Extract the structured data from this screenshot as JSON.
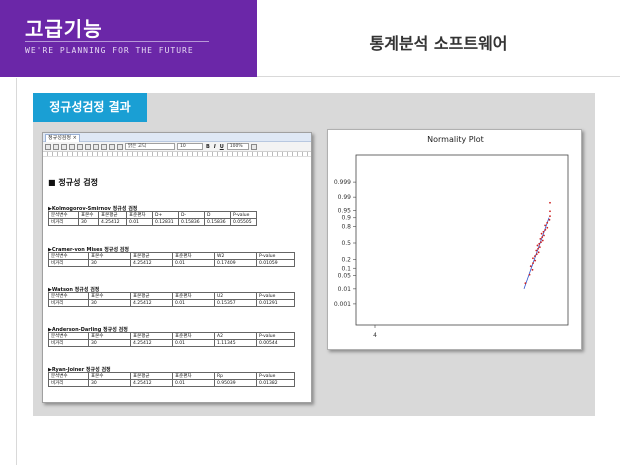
{
  "brand": {
    "title": "고급기능",
    "subtitle": "WE'RE PLANNING FOR THE FUTURE"
  },
  "header": {
    "title": "통계분석 소프트웨어"
  },
  "section": {
    "title": "정규성검정 결과"
  },
  "document": {
    "tab_label": "정규성검정",
    "tab_close": "×",
    "toolbar": {
      "font": "맑은 고딕",
      "size": "10",
      "bold": "B",
      "italic": "I",
      "underline": "U",
      "zoom": "100%"
    },
    "heading": "■ 정규성 검정",
    "tests": [
      {
        "title": "▶Kolmogorov-Smirnov 정규성 검정",
        "headers": [
          "분석변수",
          "표본수",
          "표본평균",
          "표준편차",
          "D+",
          "D-",
          "D",
          "P-value"
        ],
        "row": [
          "비거리",
          "30",
          "4.25412",
          "0.01",
          "0.12831",
          "0.15836",
          "0.15836",
          "0.05505"
        ]
      },
      {
        "title": "▶Cramer-von Mises 정규성 검정",
        "headers": [
          "분석변수",
          "표본수",
          "표본평균",
          "표준편차",
          "W2",
          "P-value"
        ],
        "row": [
          "비거리",
          "30",
          "4.25412",
          "0.01",
          "0.17409",
          "0.01059"
        ]
      },
      {
        "title": "▶Watson 정규성 검정",
        "headers": [
          "분석변수",
          "표본수",
          "표본평균",
          "표준편차",
          "U2",
          "P-value"
        ],
        "row": [
          "비거리",
          "30",
          "4.25412",
          "0.01",
          "0.15357",
          "0.01291"
        ]
      },
      {
        "title": "▶Anderson-Darling 정규성 검정",
        "headers": [
          "분석변수",
          "표본수",
          "표본평균",
          "표준편차",
          "A2",
          "P-value"
        ],
        "row": [
          "비거리",
          "30",
          "4.25412",
          "0.01",
          "1.11345",
          "0.00544"
        ]
      },
      {
        "title": "▶Ryan-Joiner 정규성 검정",
        "headers": [
          "분석변수",
          "표본수",
          "표본평균",
          "표준편차",
          "Rp",
          "P-value"
        ],
        "row": [
          "비거리",
          "30",
          "4.25412",
          "0.01",
          "0.95039",
          "0.01382"
        ]
      }
    ]
  },
  "chart_data": {
    "type": "scatter",
    "title": "Normality Plot",
    "y_ticks": [
      "0.999",
      "0.99",
      "0.95",
      "0.9",
      "0.8",
      "0.5",
      "0.2",
      "0.1",
      "0.05",
      "0.01",
      "0.001"
    ],
    "x_ticks": [
      "4"
    ],
    "point_color": "#cc2222",
    "line_color": "#3355cc"
  }
}
